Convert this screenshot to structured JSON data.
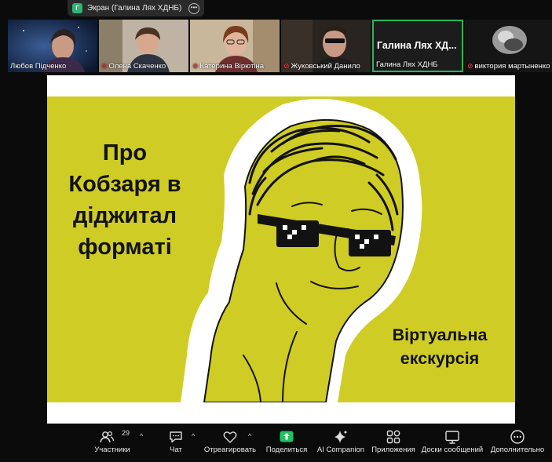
{
  "share_banner": {
    "badge": "Г",
    "title": "Экран (Галина Лях ХДНБ)",
    "more": "•••"
  },
  "participants": [
    {
      "name": "Любов Підченко",
      "muted": false
    },
    {
      "name": "Олена Скаченко",
      "muted": true
    },
    {
      "name": "Катерина Вірютіна",
      "muted": true
    },
    {
      "name": "Жуковський Данило",
      "muted": true
    },
    {
      "name": "Галина Лях ХДНБ",
      "display_name": "Галина Лях ХД...",
      "muted": false,
      "active": true
    },
    {
      "name": "виктория мартыненко",
      "muted": true
    }
  ],
  "slide": {
    "left_lines": [
      "Про",
      "Кобзаря в",
      "діджитал",
      "форматі"
    ],
    "right_lines": [
      "Віртуальна",
      "екскурсія"
    ],
    "colors": {
      "background": "#cfcc25",
      "ink": "#121212"
    }
  },
  "toolbar": {
    "participants": {
      "label": "Участники",
      "count": "29"
    },
    "chat": {
      "label": "Чат"
    },
    "react": {
      "label": "Отреагировать"
    },
    "share": {
      "label": "Поделиться"
    },
    "ai": {
      "label": "AI Companion"
    },
    "apps": {
      "label": "Приложения"
    },
    "whiteboards": {
      "label": "Доски сообщений"
    },
    "more": {
      "label": "Дополнительно"
    },
    "caret": "^"
  },
  "colors": {
    "accent_green": "#2ab55c",
    "muted_red": "#e4383b",
    "share_green": "#23c160"
  }
}
